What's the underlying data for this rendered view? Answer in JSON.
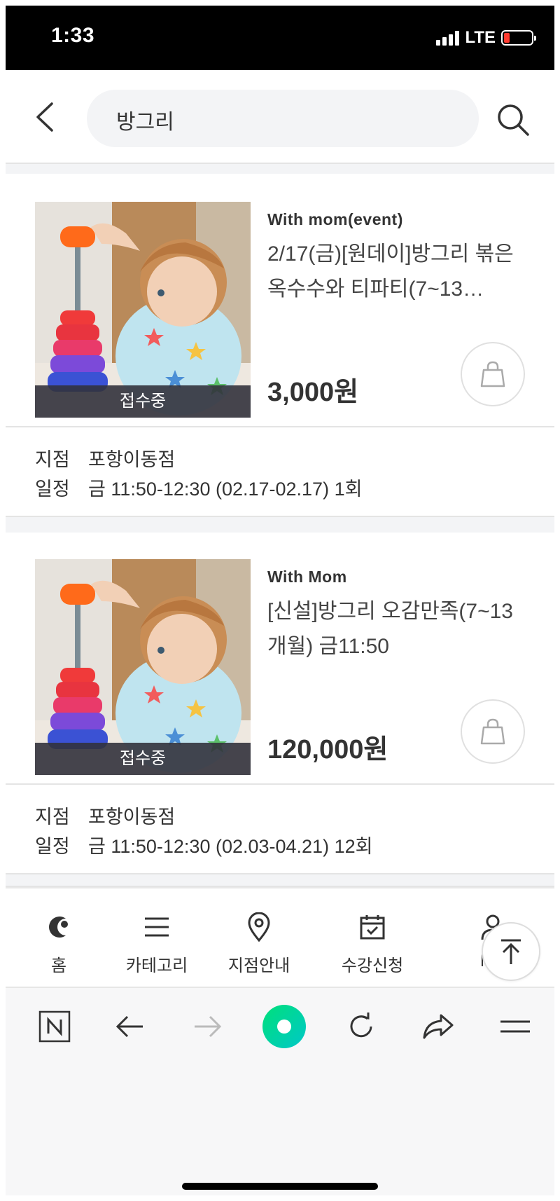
{
  "status_bar": {
    "time": "1:33",
    "network": "LTE",
    "battery_color": "#ff3b30"
  },
  "header": {
    "search_value": "방그리"
  },
  "products": [
    {
      "badge": "접수중",
      "category": "With mom(event)",
      "title": "2/17(금)[원데이]방그리 볶은 옥수수와 티파티(7~13…",
      "price": "3,000원",
      "branch_label": "지점",
      "branch": "포항이동점",
      "schedule_label": "일정",
      "schedule": "금 11:50-12:30 (02.17-02.17) 1회"
    },
    {
      "badge": "접수중",
      "category": "With Mom",
      "title": "[신설]방그리 오감만족(7~13개월) 금11:50",
      "price": "120,000원",
      "branch_label": "지점",
      "branch": "포항이동점",
      "schedule_label": "일정",
      "schedule": "금 11:50-12:30 (02.03-04.21) 12회"
    }
  ],
  "app_nav": {
    "items": [
      {
        "label": "홈",
        "icon": "home-c-logo-icon"
      },
      {
        "label": "카테고리",
        "icon": "menu-icon"
      },
      {
        "label": "지점안내",
        "icon": "location-pin-icon"
      },
      {
        "label": "수강신청",
        "icon": "calendar-check-icon"
      },
      {
        "label": "MY",
        "icon": "user-icon"
      }
    ]
  },
  "browser_bar": {
    "items": [
      "naver-n-icon",
      "back-arrow-icon",
      "forward-arrow-icon",
      "green-dot-icon",
      "refresh-icon",
      "share-icon",
      "menu-icon"
    ],
    "accent": "#00d5a0"
  }
}
